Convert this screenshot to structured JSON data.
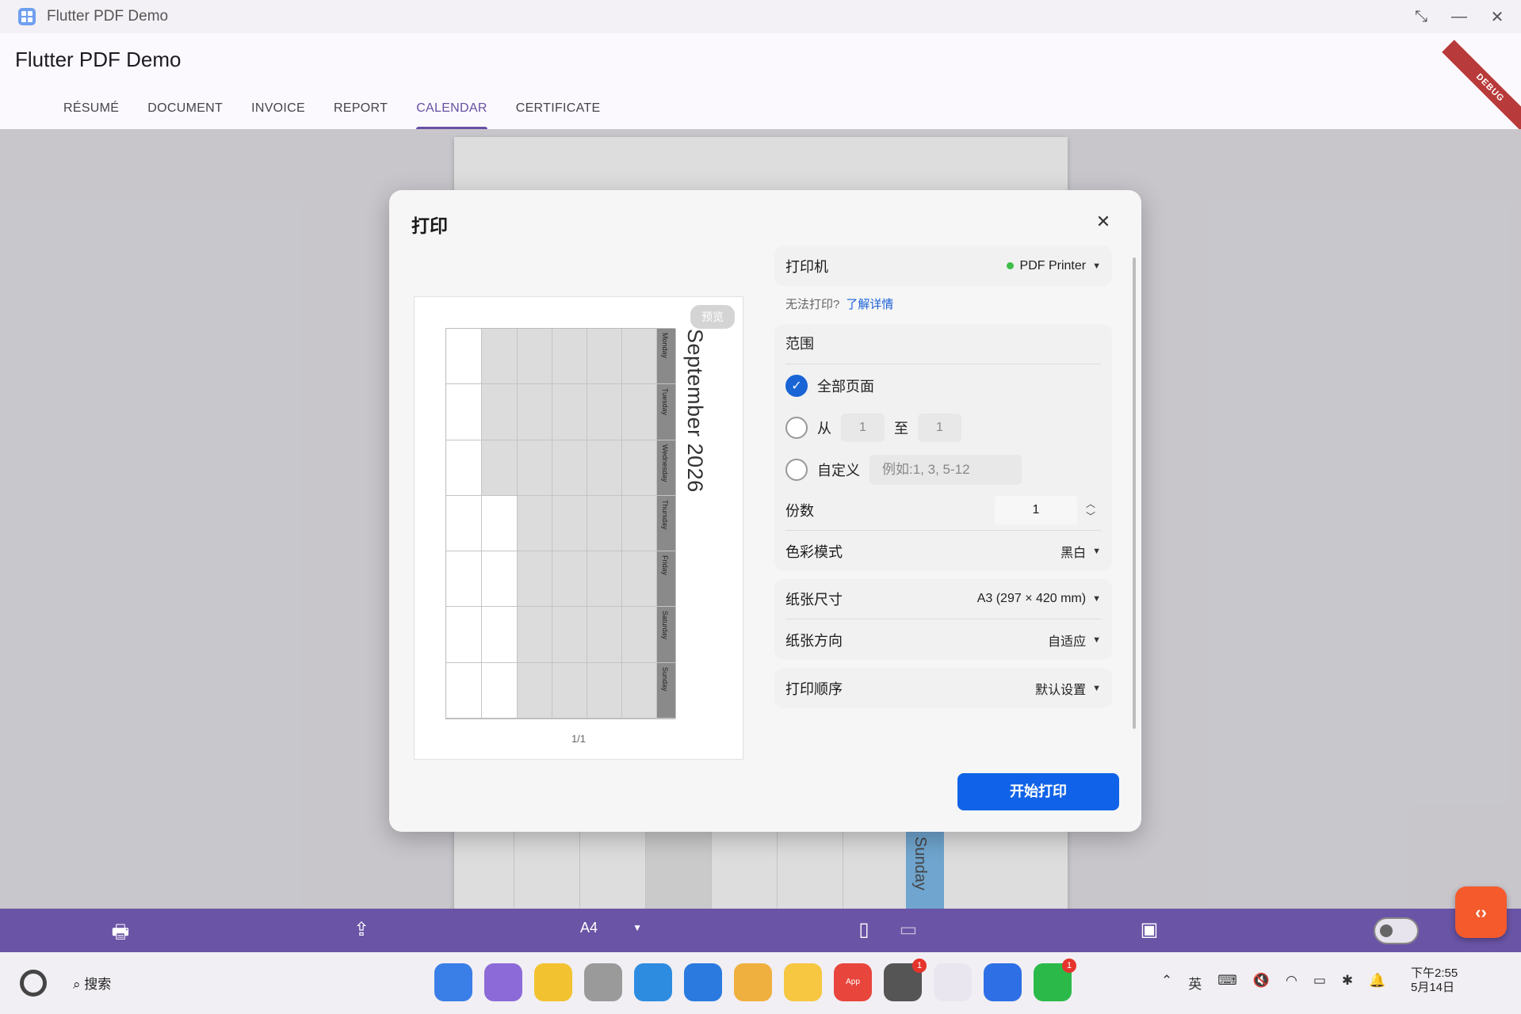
{
  "window": {
    "title": "Flutter PDF Demo",
    "controls": [
      "⤡",
      "—",
      "✕"
    ]
  },
  "app": {
    "title": "Flutter PDF Demo",
    "debug_label": "DEBUG",
    "tabs": [
      "RÉSUMÉ",
      "DOCUMENT",
      "INVOICE",
      "REPORT",
      "CALENDAR",
      "CERTIFICATE"
    ],
    "active_tab": "CALENDAR"
  },
  "background": {
    "sunday_label": "Sunday"
  },
  "dialog": {
    "title": "打印",
    "close": "✕",
    "preview_badge": "预览",
    "calendar_title": "September 2026",
    "weekdays": [
      "Monday",
      "Tuesday",
      "Wednesday",
      "Thursday",
      "Friday",
      "Saturday",
      "Sunday"
    ],
    "page_indicator": "1/1",
    "printer_label": "打印机",
    "printer_value": "PDF Printer",
    "help_text": "无法打印?",
    "help_link": "了解详情",
    "range_title": "范围",
    "all_pages": "全部页面",
    "from_label": "从",
    "from_value": "1",
    "to_label": "至",
    "to_value": "1",
    "custom_label": "自定义",
    "custom_placeholder": "例如:1, 3, 5-12",
    "copies_label": "份数",
    "copies_value": "1",
    "color_label": "色彩模式",
    "color_value": "黑白",
    "paper_size_label": "纸张尺寸",
    "paper_size_value": "A3 (297 × 420 mm)",
    "orientation_label": "纸张方向",
    "orientation_value": "自适应",
    "order_label": "打印顺序",
    "order_value": "默认设置",
    "print_button": "开始打印"
  },
  "toolbar": {
    "page_format": "A4"
  },
  "taskbar": {
    "search_label": "搜索",
    "tray_lang": "英",
    "clock_time": "下午2:55",
    "clock_date": "5月14日",
    "app_gallery_label": "App Gallery"
  }
}
